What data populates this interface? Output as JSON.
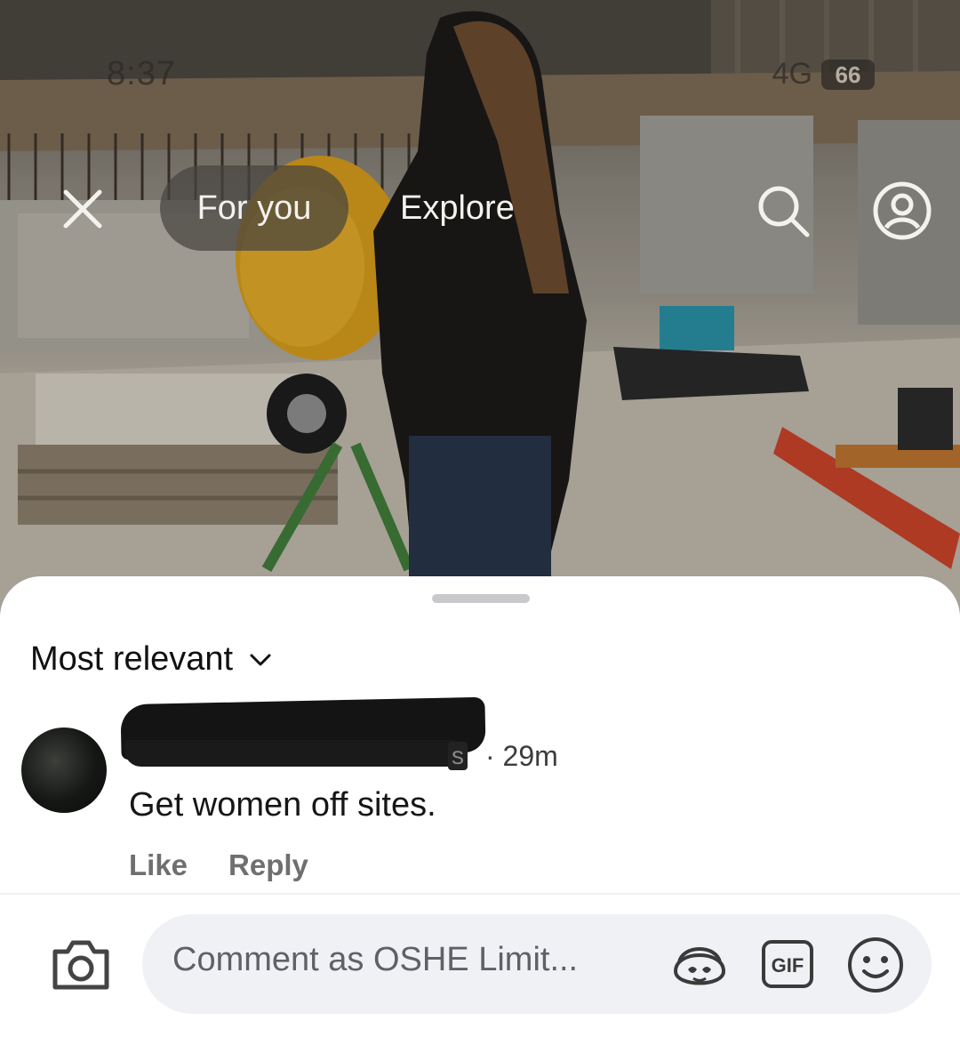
{
  "status_bar": {
    "time": "8:37",
    "network": "4G",
    "battery": "66"
  },
  "reel_nav": {
    "tab_for_you": "For you",
    "tab_explore": "Explore"
  },
  "comments_sheet": {
    "sort_label": "Most relevant",
    "comments": [
      {
        "username_suffix": "s",
        "time": "· 29m",
        "text": "Get women off sites.",
        "like_label": "Like",
        "reply_label": "Reply"
      }
    ],
    "composer": {
      "placeholder": "Comment as OSHE Limit..."
    }
  }
}
